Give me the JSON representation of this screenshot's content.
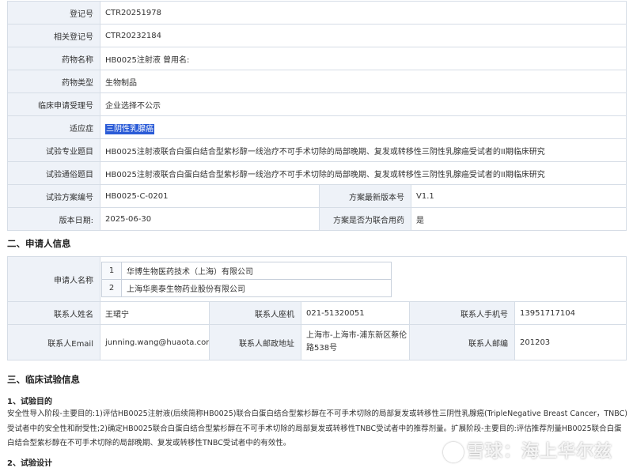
{
  "basic": {
    "reg_no_label": "登记号",
    "reg_no": "CTR20251978",
    "related_label": "相关登记号",
    "related": "CTR20232184",
    "drug_name_label": "药物名称",
    "drug_name": "HB0025注射液   曾用名:",
    "drug_type_label": "药物类型",
    "drug_type": "生物制品",
    "accept_label": "临床申请受理号",
    "accept": "企业选择不公示",
    "indication_label": "适应症",
    "indication": "三阴性乳腺癌",
    "pro_title_label": "试验专业题目",
    "pro_title": "HB0025注射液联合白蛋白结合型紫杉醇一线治疗不可手术切除的局部晚期、复发或转移性三阴性乳腺癌受试者的II期临床研究",
    "pop_title_label": "试验通俗题目",
    "pop_title": "HB0025注射液联合白蛋白结合型紫杉醇一线治疗不可手术切除的局部晚期、复发或转移性三阴性乳腺癌受试者的II期临床研究",
    "protocol_label": "试验方案编号",
    "protocol": "HB0025-C-0201",
    "version_label": "方案最新版本号",
    "version": "V1.1",
    "date_label": "版本日期:",
    "date": "2025-06-30",
    "combo_label": "方案是否为联合用药",
    "combo": "是"
  },
  "applicant": {
    "section_title": "二、申请人信息",
    "name_label": "申请人名称",
    "names": [
      {
        "num": "1",
        "name": "华博生物医药技术（上海）有限公司"
      },
      {
        "num": "2",
        "name": "上海华奥泰生物药业股份有限公司"
      }
    ],
    "contact_label": "联系人姓名",
    "contact": "王珺宁",
    "phone_label": "联系人座机",
    "phone": "021-51320051",
    "mobile_label": "联系人手机号",
    "mobile": "13951717104",
    "email_label": "联系人Email",
    "email": "junning.wang@huaota.com",
    "address_label": "联系人邮政地址",
    "address_line1": "上海市-上海市-浦东新区蔡伦",
    "address_line2": "路538号",
    "zip_label": "联系人邮编",
    "zip": "201203"
  },
  "trial": {
    "section_title": "三、临床试验信息",
    "purpose_title": "1、试验目的",
    "purpose_text": "安全性导入阶段-主要目的:1)评估HB0025注射液(后续简称HB0025)联合白蛋白结合型紫杉醇在不可手术切除的局部复发或转移性三阴性乳腺癌(TripleNegative Breast Cancer，TNBC)受试者中的安全性和耐受性;2)确定HB0025联合白蛋白结合型紫杉醇在不可手术切除的局部复发或转移性TNBC受试者中的推荐剂量。扩展阶段-主要目的:评估推荐剂量HB0025联合白蛋白结合型紫杉醇在不可手术切除的局部晚期、复发或转移性TNBC受试者中的有效性。",
    "design_title": "2、试验设计"
  },
  "watermark": {
    "text": "雪球：海上华尔兹"
  }
}
